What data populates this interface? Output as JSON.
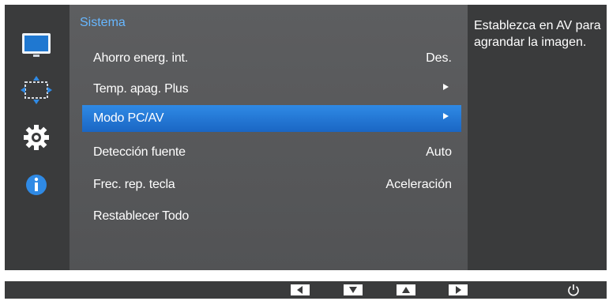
{
  "menu": {
    "section_title": "Sistema",
    "items": [
      {
        "label": "Ahorro energ. int.",
        "value": "Des.",
        "arrow": false,
        "selected": false
      },
      {
        "label": "Temp. apag. Plus",
        "value": "",
        "arrow": true,
        "selected": false
      },
      {
        "label": "Modo PC/AV",
        "value": "",
        "arrow": true,
        "selected": true
      },
      {
        "label": "Detección fuente",
        "value": "Auto",
        "arrow": false,
        "selected": false
      },
      {
        "label": "Frec. rep. tecla",
        "value": "Aceleración",
        "arrow": false,
        "selected": false
      },
      {
        "label": "Restablecer Todo",
        "value": "",
        "arrow": false,
        "selected": false
      }
    ]
  },
  "help": {
    "text": "Establezca en AV para agrandar la imagen."
  },
  "sidebar": {
    "icons": [
      "picture-icon",
      "onscreen-display-icon",
      "system-gear-icon",
      "information-icon"
    ],
    "active": "system-gear-icon"
  },
  "bottom_bar": {
    "buttons": [
      "left-arrow-icon",
      "down-arrow-icon",
      "up-arrow-icon",
      "right-arrow-icon",
      "power-icon"
    ]
  },
  "colors": {
    "accent_title": "#67b7ff",
    "selection": "#1f70cf",
    "panel": "#5a5b5d",
    "frame": "#3a3b3c"
  }
}
